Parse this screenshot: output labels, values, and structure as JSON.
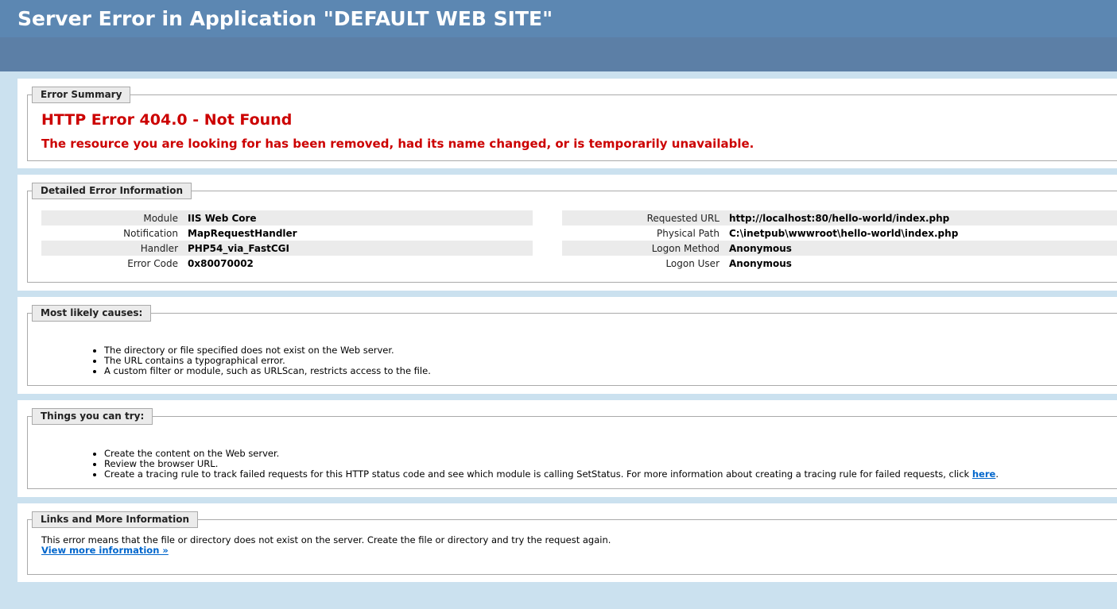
{
  "header": {
    "title": "Server Error in Application \"DEFAULT WEB SITE\""
  },
  "summary": {
    "legend": "Error Summary",
    "title": "HTTP Error 404.0 - Not Found",
    "message": "The resource you are looking for has been removed, had its name changed, or is temporarily unavailable."
  },
  "detail": {
    "legend": "Detailed Error Information",
    "left": [
      {
        "label": "Module",
        "value": "IIS Web Core"
      },
      {
        "label": "Notification",
        "value": "MapRequestHandler"
      },
      {
        "label": "Handler",
        "value": "PHP54_via_FastCGI"
      },
      {
        "label": "Error Code",
        "value": "0x80070002"
      }
    ],
    "right": [
      {
        "label": "Requested URL",
        "value": "http://localhost:80/hello-world/index.php"
      },
      {
        "label": "Physical Path",
        "value": "C:\\inetpub\\wwwroot\\hello-world\\index.php"
      },
      {
        "label": "Logon Method",
        "value": "Anonymous"
      },
      {
        "label": "Logon User",
        "value": "Anonymous"
      }
    ]
  },
  "causes": {
    "legend": "Most likely causes:",
    "items": [
      "The directory or file specified does not exist on the Web server.",
      "The URL contains a typographical error.",
      "A custom filter or module, such as URLScan, restricts access to the file."
    ]
  },
  "try": {
    "legend": "Things you can try:",
    "items": [
      "Create the content on the Web server.",
      "Review the browser URL."
    ],
    "last_item_text": "Create a tracing rule to track failed requests for this HTTP status code and see which module is calling SetStatus. For more information about creating a tracing rule for failed requests, click ",
    "last_item_link": "here",
    "last_item_end": "."
  },
  "links": {
    "legend": "Links and More Information",
    "text": "This error means that the file or directory does not exist on the server. Create the file or directory and try the request again.",
    "more_link": "View more information »"
  }
}
